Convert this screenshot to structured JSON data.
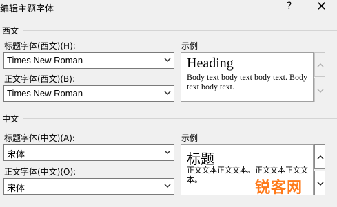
{
  "window": {
    "title": "编辑主题字体",
    "help_label": "?",
    "close_label": "✕"
  },
  "western": {
    "group_label": "西文",
    "heading_label": "标题字体(西文)(H):",
    "heading_value": "Times New Roman",
    "body_label": "正文字体(西文)(B):",
    "body_value": "Times New Roman",
    "sample_label": "示例",
    "sample_heading": "Heading",
    "sample_body": "Body text body text body text. Body text body text."
  },
  "chinese": {
    "group_label": "中文",
    "heading_label": "标题字体(中文)(A):",
    "heading_value": "宋体",
    "body_label": "正文字体(中文)(O):",
    "body_value": "宋体",
    "sample_label": "示例",
    "sample_heading": "标题",
    "sample_body": "正文文本正文文本。正文文本正文文本。"
  },
  "icons": {
    "dropdown": "chevron-down-icon",
    "scroll_up": "chevron-up-icon",
    "scroll_down": "chevron-down-icon"
  },
  "watermark": "锐客网"
}
